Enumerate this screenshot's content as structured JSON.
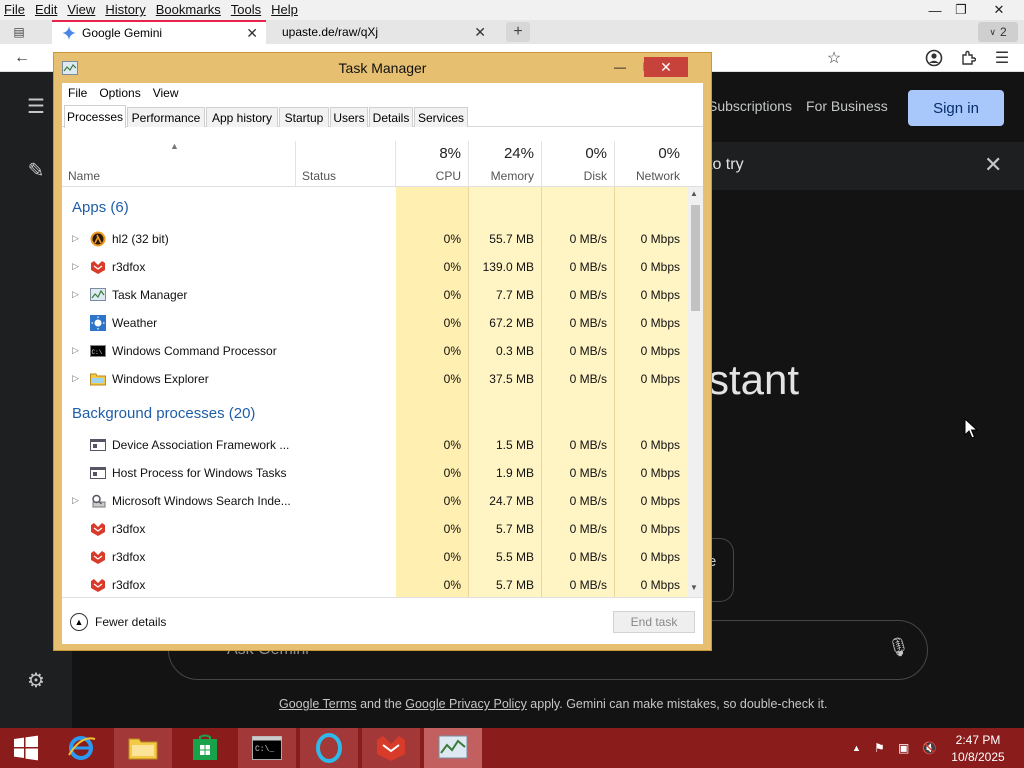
{
  "browser": {
    "menu": [
      "File",
      "Edit",
      "View",
      "History",
      "Bookmarks",
      "Tools",
      "Help"
    ],
    "tabs": [
      {
        "title": "Google Gemini"
      },
      {
        "title": "upaste.de/raw/qXj"
      }
    ],
    "new_tab": "+",
    "tab_count": "2"
  },
  "gemini": {
    "links": [
      "Subscriptions",
      "For Business"
    ],
    "sign_in": "Sign in",
    "banner_text": "to try",
    "heading": "stant",
    "chip_text": "e",
    "prompt_placeholder": "Ask Gemini",
    "footer": {
      "terms": "Google Terms",
      "and_the": " and the ",
      "privacy": "Google Privacy Policy",
      "rest": " apply. Gemini can make mistakes, so double-check it."
    }
  },
  "task_manager": {
    "title": "Task Manager",
    "menu": [
      "File",
      "Options",
      "View"
    ],
    "tabs": [
      "Processes",
      "Performance",
      "App history",
      "Startup",
      "Users",
      "Details",
      "Services"
    ],
    "active_tab": "Processes",
    "columns": {
      "name": "Name",
      "status": "Status",
      "cpu": {
        "pct": "8%",
        "label": "CPU"
      },
      "memory": {
        "pct": "24%",
        "label": "Memory"
      },
      "disk": {
        "pct": "0%",
        "label": "Disk"
      },
      "network": {
        "pct": "0%",
        "label": "Network"
      }
    },
    "groups": [
      {
        "title": "Apps (6)",
        "rows": [
          {
            "name": "hl2 (32 bit)",
            "icon": "halflife-icon",
            "expandable": true,
            "cpu": "0%",
            "memory": "55.7 MB",
            "disk": "0 MB/s",
            "network": "0 Mbps"
          },
          {
            "name": "r3dfox",
            "icon": "r3dfox-icon",
            "expandable": true,
            "cpu": "0%",
            "memory": "139.0 MB",
            "disk": "0 MB/s",
            "network": "0 Mbps"
          },
          {
            "name": "Task Manager",
            "icon": "task-manager-icon",
            "expandable": true,
            "cpu": "0%",
            "memory": "7.7 MB",
            "disk": "0 MB/s",
            "network": "0 Mbps"
          },
          {
            "name": "Weather",
            "icon": "weather-icon",
            "expandable": false,
            "cpu": "0%",
            "memory": "67.2 MB",
            "disk": "0 MB/s",
            "network": "0 Mbps"
          },
          {
            "name": "Windows Command Processor",
            "icon": "cmd-icon",
            "expandable": true,
            "cpu": "0%",
            "memory": "0.3 MB",
            "disk": "0 MB/s",
            "network": "0 Mbps"
          },
          {
            "name": "Windows Explorer",
            "icon": "explorer-icon",
            "expandable": true,
            "cpu": "0%",
            "memory": "37.5 MB",
            "disk": "0 MB/s",
            "network": "0 Mbps"
          }
        ]
      },
      {
        "title": "Background processes (20)",
        "rows": [
          {
            "name": "Device Association Framework ...",
            "icon": "service-icon",
            "expandable": false,
            "cpu": "0%",
            "memory": "1.5 MB",
            "disk": "0 MB/s",
            "network": "0 Mbps"
          },
          {
            "name": "Host Process for Windows Tasks",
            "icon": "service-icon",
            "expandable": false,
            "cpu": "0%",
            "memory": "1.9 MB",
            "disk": "0 MB/s",
            "network": "0 Mbps"
          },
          {
            "name": "Microsoft Windows Search Inde...",
            "icon": "search-indexer-icon",
            "expandable": true,
            "cpu": "0%",
            "memory": "24.7 MB",
            "disk": "0 MB/s",
            "network": "0 Mbps"
          },
          {
            "name": "r3dfox",
            "icon": "r3dfox-icon",
            "expandable": false,
            "cpu": "0%",
            "memory": "5.7 MB",
            "disk": "0 MB/s",
            "network": "0 Mbps"
          },
          {
            "name": "r3dfox",
            "icon": "r3dfox-icon",
            "expandable": false,
            "cpu": "0%",
            "memory": "5.5 MB",
            "disk": "0 MB/s",
            "network": "0 Mbps"
          },
          {
            "name": "r3dfox",
            "icon": "r3dfox-icon",
            "expandable": false,
            "cpu": "0%",
            "memory": "5.7 MB",
            "disk": "0 MB/s",
            "network": "0 Mbps"
          }
        ]
      }
    ],
    "fewer_details": "Fewer details",
    "end_task": "End task"
  },
  "taskbar": {
    "apps": [
      "internet-explorer-icon",
      "file-explorer-icon",
      "store-icon",
      "cmd-icon",
      "opera-icon",
      "r3dfox-icon",
      "task-manager-icon"
    ],
    "time": "2:47 PM",
    "date": "10/8/2025"
  }
}
